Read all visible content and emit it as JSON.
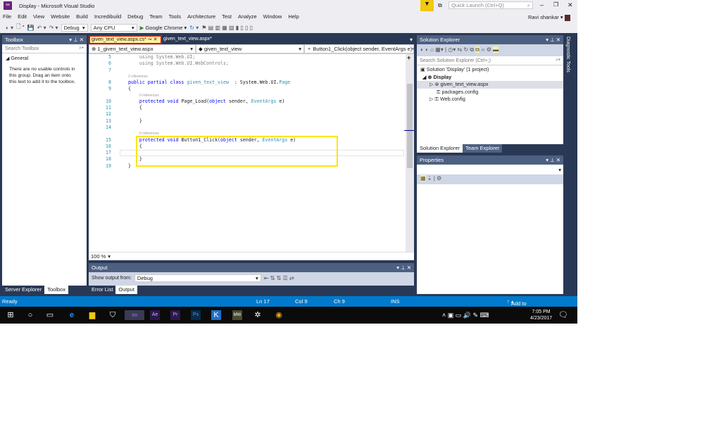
{
  "window": {
    "title": "Display - Microsoft Visual Studio",
    "quick_launch": "Quick Launch (Ctrl+Q)",
    "user": "Ravi shankar"
  },
  "menu": [
    "File",
    "Edit",
    "View",
    "Website",
    "Build",
    "Incredibuild",
    "Debug",
    "Team",
    "Tools",
    "Architecture",
    "Test",
    "Analyze",
    "Window",
    "Help"
  ],
  "toolbar": {
    "config": "Debug",
    "platform": "Any CPU",
    "run_target": "Google Chrome"
  },
  "toolbox": {
    "title": "Toolbox",
    "search_placeholder": "Search Toolbox",
    "group": "General",
    "empty_text": "There are no usable controls in this group. Drag an item onto this text to add it to the toolbox.",
    "tabs": [
      "Server Explorer",
      "Toolbox"
    ]
  },
  "editor": {
    "tabs": [
      "given_text_view.aspx.cs*",
      "given_text_view.aspx*"
    ],
    "nav": [
      "1_given_text_view.aspx",
      "given_text_view",
      "Button1_Click(object sender, EventArgs e)"
    ],
    "zoom": "100 %",
    "lines": [
      {
        "n": "5",
        "t": "    using System.Web.UI;",
        "gray": true
      },
      {
        "n": "6",
        "t": "    using System.Web.UI.WebControls;",
        "gray": true
      },
      {
        "n": "7",
        "t": ""
      },
      {
        "ref": "2 references"
      },
      {
        "n": "8",
        "h": [
          [
            "kw",
            "public partial class "
          ],
          [
            "ty",
            "given_text_view"
          ],
          [
            "",
            "  : System.Web.UI."
          ],
          [
            "ty",
            "Page"
          ]
        ]
      },
      {
        "n": "9",
        "t": "{"
      },
      {
        "ref": "0 references",
        "indent": true
      },
      {
        "n": "10",
        "h": [
          [
            "kw",
            "    protected void "
          ],
          [
            "",
            "Page_Load("
          ],
          [
            "kw",
            "object"
          ],
          [
            "",
            " sender, "
          ],
          [
            "ty",
            "EventArgs"
          ],
          [
            "",
            " e)"
          ]
        ]
      },
      {
        "n": "11",
        "t": "    {"
      },
      {
        "n": "12",
        "t": ""
      },
      {
        "n": "13",
        "t": "    }"
      },
      {
        "n": "14",
        "t": ""
      },
      {
        "ref": "0 references",
        "indent": true
      },
      {
        "n": "15",
        "h": [
          [
            "kw",
            "    protected void "
          ],
          [
            "",
            "Button1_Click("
          ],
          [
            "kw",
            "object"
          ],
          [
            "",
            " sender, "
          ],
          [
            "ty",
            "EventArgs"
          ],
          [
            "",
            " e)"
          ]
        ]
      },
      {
        "n": "16",
        "t": "    {"
      },
      {
        "n": "17",
        "t": ""
      },
      {
        "n": "18",
        "t": "    }"
      },
      {
        "n": "19",
        "t": "}"
      }
    ]
  },
  "output": {
    "title": "Output",
    "show_from_label": "Show output from:",
    "source": "Debug",
    "tabs": [
      "Error List",
      "Output"
    ]
  },
  "solution": {
    "title": "Solution Explorer",
    "search_placeholder": "Search Solution Explorer (Ctrl+;)",
    "items": [
      "Solution 'Display' (1 project)",
      "Display",
      "given_text_view.aspx",
      "packages.config",
      "Web.config"
    ],
    "tabs": [
      "Solution Explorer",
      "Team Explorer"
    ]
  },
  "properties": {
    "title": "Properties"
  },
  "diagnostic": "Diagnostic Tools",
  "status": {
    "ready": "Ready",
    "ln": "Ln 17",
    "col": "Col 9",
    "ch": "Ch 9",
    "ins": "INS",
    "source_control": "Add to Source Control"
  },
  "taskbar": {
    "time": "7:05 PM",
    "date": "4/23/2017"
  },
  "colors": {
    "accent": "#007acc",
    "highlight": "#ffe600",
    "tab_active": "#fff29d"
  }
}
